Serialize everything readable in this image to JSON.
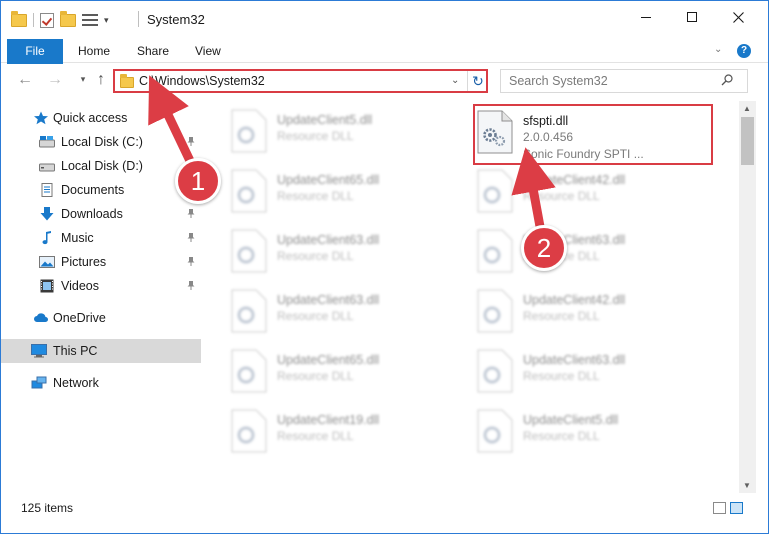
{
  "window": {
    "title": "System32",
    "accent": "#1979ca",
    "annotation_color": "#dc3d45"
  },
  "ribbon": {
    "tabs": [
      {
        "label": "File",
        "active": true
      },
      {
        "label": "Home"
      },
      {
        "label": "Share"
      },
      {
        "label": "View"
      }
    ],
    "help_label": "?"
  },
  "address": {
    "path": "C:\\Windows\\System32"
  },
  "search": {
    "placeholder": "Search System32"
  },
  "sidebar": {
    "items": [
      {
        "label": "Quick access",
        "icon": "star-icon"
      },
      {
        "label": "Local Disk (C:)",
        "icon": "drive-icon",
        "pinned": true
      },
      {
        "label": "Local Disk (D:)",
        "icon": "drive-icon",
        "pinned": true
      },
      {
        "label": "Documents",
        "icon": "documents-icon",
        "pinned": true
      },
      {
        "label": "Downloads",
        "icon": "download-icon",
        "pinned": true
      },
      {
        "label": "Music",
        "icon": "music-icon",
        "pinned": true
      },
      {
        "label": "Pictures",
        "icon": "pictures-icon",
        "pinned": true
      },
      {
        "label": "Videos",
        "icon": "videos-icon",
        "pinned": true
      },
      {
        "label": "OneDrive",
        "icon": "cloud-icon"
      },
      {
        "label": "This PC",
        "icon": "computer-icon",
        "selected": true
      },
      {
        "label": "Network",
        "icon": "network-icon"
      }
    ]
  },
  "files": {
    "left": [
      {
        "name": "UpdateClient5.dll",
        "type": "Resource DLL"
      },
      {
        "name": "UpdateClient65.dll",
        "type": "Resource DLL"
      },
      {
        "name": "UpdateClient63.dll",
        "type": "Resource DLL"
      },
      {
        "name": "UpdateClient63.dll",
        "type": "Resource DLL"
      },
      {
        "name": "UpdateClient65.dll",
        "type": "Resource DLL"
      },
      {
        "name": "UpdateClient19.dll",
        "type": "Resource DLL"
      }
    ],
    "right": [
      {
        "name": "sfspti.dll",
        "version": "2.0.0.456",
        "type": "Sonic Foundry SPTI ...",
        "highlighted": true
      },
      {
        "name": "UpdateClient42.dll",
        "type": "Resource DLL"
      },
      {
        "name": "UpdateClient63.dll",
        "type": "Resource DLL"
      },
      {
        "name": "UpdateClient42.dll",
        "type": "Resource DLL"
      },
      {
        "name": "UpdateClient63.dll",
        "type": "Resource DLL"
      },
      {
        "name": "UpdateClient5.dll",
        "type": "Resource DLL"
      }
    ]
  },
  "status": {
    "item_count": "125 items"
  },
  "annotations": {
    "step1": "1",
    "step2": "2"
  }
}
